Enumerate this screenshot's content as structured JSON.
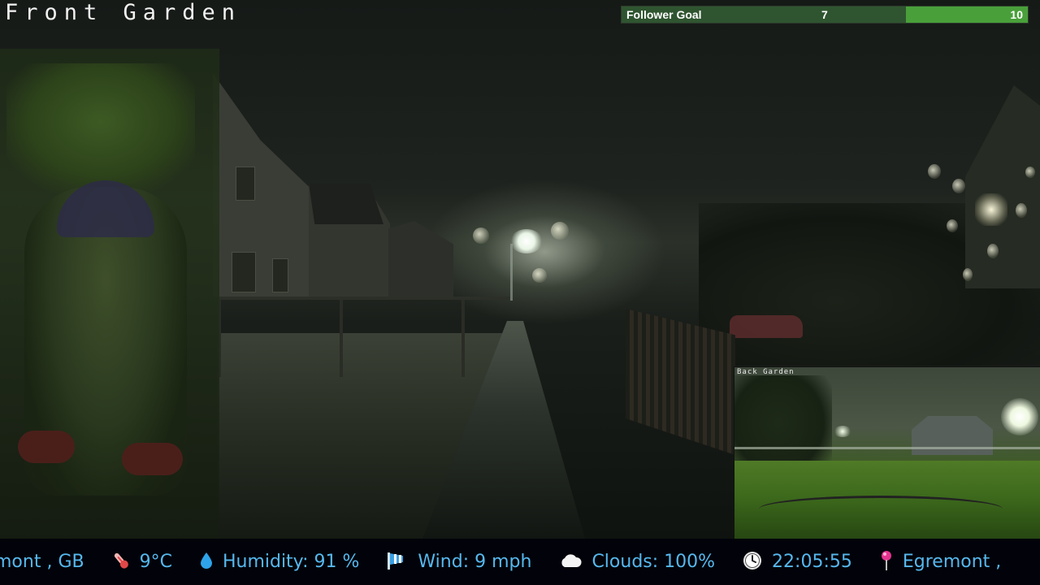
{
  "camera": {
    "title": "Front Garden"
  },
  "follower_goal": {
    "label": "Follower Goal",
    "current": 7,
    "target": 10,
    "current_text": "7",
    "target_text": "10",
    "progress": 0.7
  },
  "pip": {
    "title": "Back Garden"
  },
  "ticker": {
    "location_partial": "mont , GB",
    "temperature": "9°C",
    "humidity": "Humidity: 91 %",
    "wind": "Wind: 9 mph",
    "clouds": "Clouds: 100%",
    "time": "22:05:55",
    "location_repeat": "Egremont ,",
    "icons": {
      "temperature": "thermometer-icon",
      "humidity": "water-drop-icon",
      "wind": "wind-sock-icon",
      "clouds": "cloud-icon",
      "time": "clock-icon",
      "location": "map-pin-icon"
    }
  }
}
